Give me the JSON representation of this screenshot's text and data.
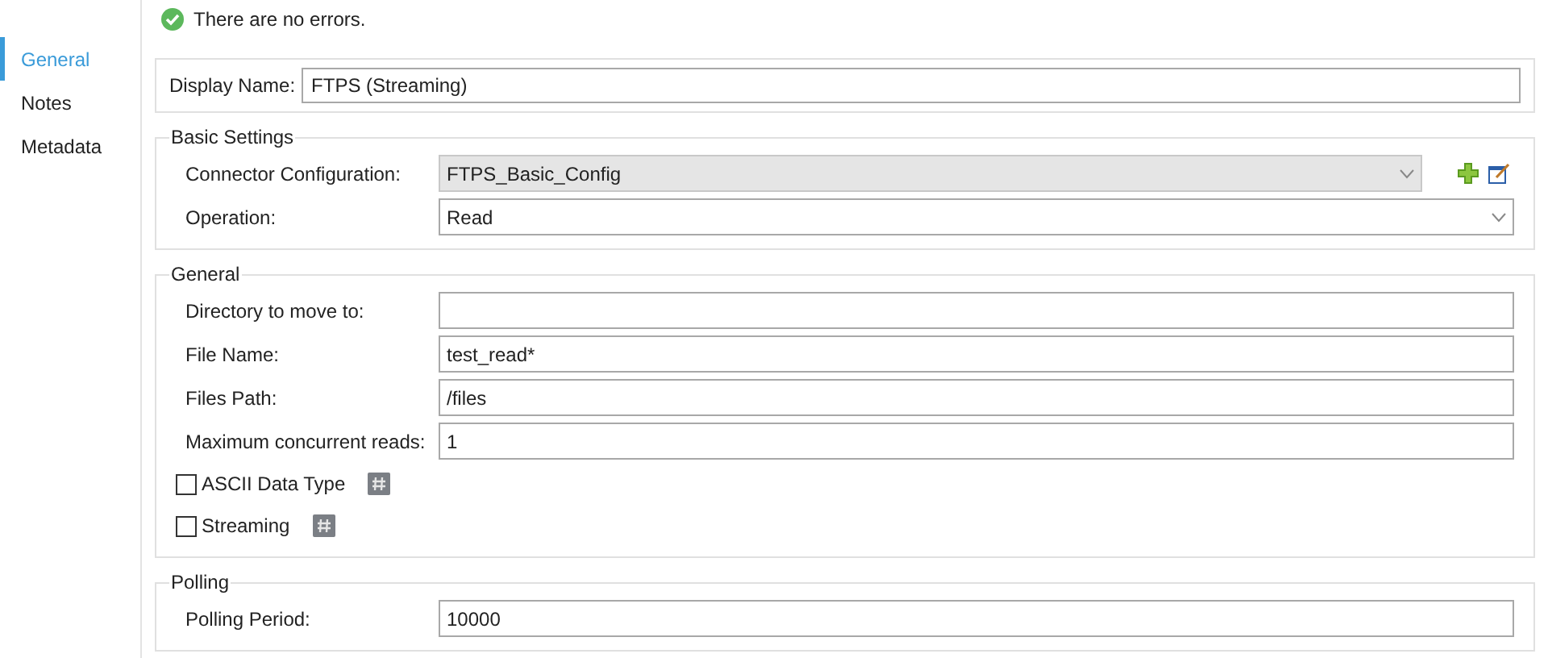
{
  "sidebar": {
    "items": [
      {
        "label": "General",
        "selected": true
      },
      {
        "label": "Notes",
        "selected": false
      },
      {
        "label": "Metadata",
        "selected": false
      }
    ]
  },
  "status": {
    "kind": "ok",
    "text": "There are no errors."
  },
  "display_name": {
    "label": "Display Name:",
    "value": "FTPS (Streaming)"
  },
  "groups": [
    {
      "title": "Basic Settings",
      "rows": [
        {
          "kind": "combo",
          "label": "Connector Configuration:",
          "value": "FTPS_Basic_Config",
          "disabled": true,
          "actions": true
        },
        {
          "kind": "combo",
          "label": "Operation:",
          "value": "Read",
          "disabled": false,
          "actions": false
        }
      ]
    },
    {
      "title": "General",
      "rows": [
        {
          "kind": "text",
          "label": "Directory to move to:",
          "value": ""
        },
        {
          "kind": "text",
          "label": "File Name:",
          "value": "test_read*"
        },
        {
          "kind": "text",
          "label": "Files Path:",
          "value": "/files"
        },
        {
          "kind": "text",
          "label": "Maximum concurrent reads:",
          "value": "1"
        },
        {
          "kind": "check",
          "label": "ASCII Data Type",
          "checked": false
        },
        {
          "kind": "check",
          "label": "Streaming",
          "checked": false
        }
      ]
    },
    {
      "title": "Polling",
      "rows": [
        {
          "kind": "text",
          "label": "Polling Period:",
          "value": "10000"
        }
      ]
    }
  ]
}
